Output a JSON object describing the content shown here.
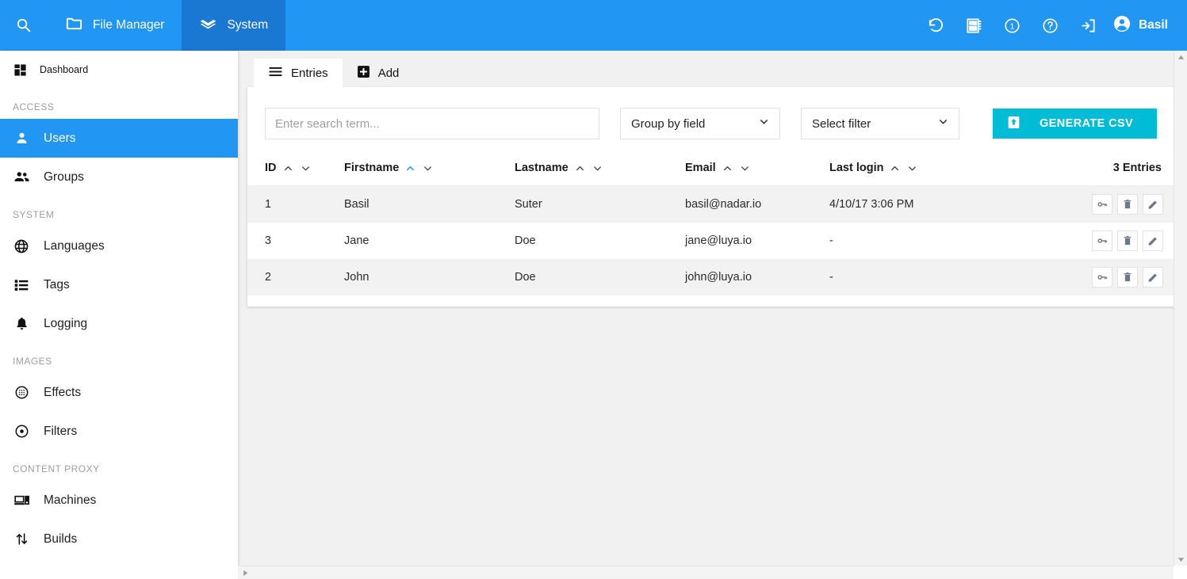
{
  "topbar": {
    "search_icon": "search-icon",
    "menu": [
      {
        "label": "File Manager",
        "icon": "folder-icon",
        "active": false
      },
      {
        "label": "System",
        "icon": "layers-icon",
        "active": true
      }
    ],
    "icons": [
      {
        "name": "history-restore-icon"
      },
      {
        "name": "dashboard-module-icon"
      },
      {
        "name": "info-badge-icon",
        "badge": "1"
      },
      {
        "name": "help-icon"
      },
      {
        "name": "logout-icon"
      }
    ],
    "user": {
      "name": "Basil",
      "icon": "account-circle-icon"
    },
    "bg_color": "#2196f3",
    "active_bg_color": "#1a77d2"
  },
  "sidebar": {
    "dashboard": {
      "label": "Dashboard",
      "icon": "dashboard-grid-icon"
    },
    "groups": [
      {
        "title": "ACCESS",
        "items": [
          {
            "label": "Users",
            "icon": "person-icon",
            "active": true
          },
          {
            "label": "Groups",
            "icon": "people-icon",
            "active": false
          }
        ]
      },
      {
        "title": "SYSTEM",
        "items": [
          {
            "label": "Languages",
            "icon": "globe-icon",
            "active": false
          },
          {
            "label": "Tags",
            "icon": "list-icon",
            "active": false
          },
          {
            "label": "Logging",
            "icon": "bell-icon",
            "active": false
          }
        ]
      },
      {
        "title": "IMAGES",
        "items": [
          {
            "label": "Effects",
            "icon": "blur-circle-icon",
            "active": false
          },
          {
            "label": "Filters",
            "icon": "target-circle-icon",
            "active": false
          }
        ]
      },
      {
        "title": "CONTENT PROXY",
        "items": [
          {
            "label": "Machines",
            "icon": "devices-icon",
            "active": false
          },
          {
            "label": "Builds",
            "icon": "transfer-arrows-icon",
            "active": false
          }
        ]
      }
    ],
    "active_color": "#2196f3"
  },
  "content": {
    "tabs": [
      {
        "label": "Entries",
        "icon": "list-menu-icon",
        "active": true
      },
      {
        "label": "Add",
        "icon": "plus-box-icon",
        "active": false
      }
    ],
    "toolbar": {
      "search_placeholder": "Enter search term...",
      "search_value": "",
      "group_by": {
        "selected": "Group by field",
        "options": [
          "Group by field"
        ]
      },
      "filter": {
        "selected": "Select filter",
        "options": [
          "Select filter"
        ]
      },
      "csv_button": {
        "label": "GENERATE CSV",
        "icon": "export-upload-icon",
        "color": "#00bcd4"
      }
    },
    "table": {
      "columns": [
        {
          "key": "id",
          "label": "ID",
          "sort_asc_active": false
        },
        {
          "key": "firstname",
          "label": "Firstname",
          "sort_asc_active": true
        },
        {
          "key": "lastname",
          "label": "Lastname",
          "sort_asc_active": false
        },
        {
          "key": "email",
          "label": "Email",
          "sort_asc_active": false
        },
        {
          "key": "lastlogin",
          "label": "Last login",
          "sort_asc_active": false
        }
      ],
      "entries_count_label": "3 Entries",
      "sort_active_color": "#2196f3",
      "rows": [
        {
          "id": "1",
          "firstname": "Basil",
          "lastname": "Suter",
          "email": "basil@nadar.io",
          "lastlogin": "4/10/17 3:06 PM"
        },
        {
          "id": "3",
          "firstname": "Jane",
          "lastname": "Doe",
          "email": "jane@luya.io",
          "lastlogin": "-"
        },
        {
          "id": "2",
          "firstname": "John",
          "lastname": "Doe",
          "email": "john@luya.io",
          "lastlogin": "-"
        }
      ],
      "row_actions": [
        {
          "name": "permissions-key-button",
          "icon": "key-icon"
        },
        {
          "name": "delete-button",
          "icon": "trash-icon"
        },
        {
          "name": "edit-button",
          "icon": "pencil-icon"
        }
      ]
    }
  }
}
